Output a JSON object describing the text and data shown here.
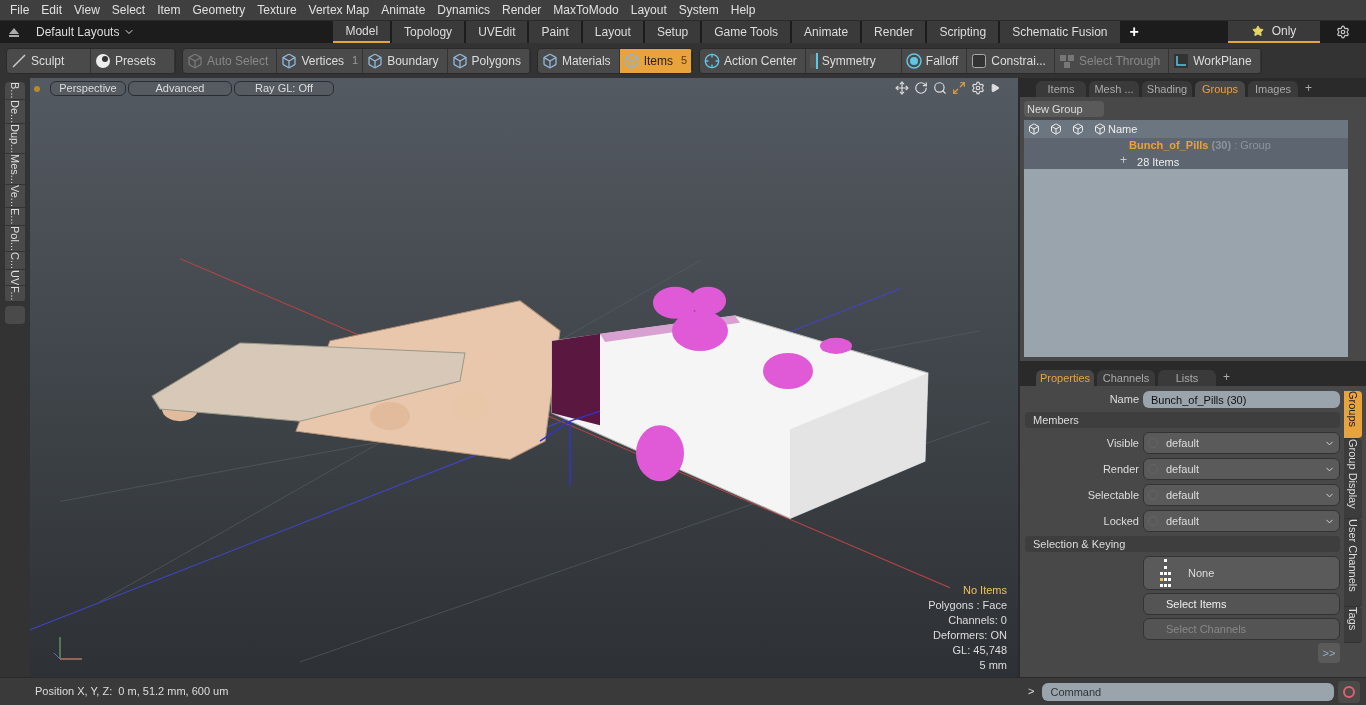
{
  "menu": [
    "File",
    "Edit",
    "View",
    "Select",
    "Item",
    "Geometry",
    "Texture",
    "Vertex Map",
    "Animate",
    "Dynamics",
    "Render",
    "MaxToModo",
    "Layout",
    "System",
    "Help"
  ],
  "layout_bar": {
    "layout_menu": "Default Layouts",
    "tabs": [
      {
        "label": "Model",
        "selected": true
      },
      {
        "label": "Topology",
        "selected": false
      },
      {
        "label": "UVEdit",
        "selected": false
      },
      {
        "label": "Paint",
        "selected": false
      },
      {
        "label": "Layout",
        "selected": false
      },
      {
        "label": "Setup",
        "selected": false
      },
      {
        "label": "Game Tools",
        "selected": false
      },
      {
        "label": "Animate",
        "selected": false
      },
      {
        "label": "Render",
        "selected": false
      },
      {
        "label": "Scripting",
        "selected": false
      },
      {
        "label": "Schematic Fusion",
        "selected": false
      }
    ],
    "add": "+",
    "only": "Only"
  },
  "toolbar": [
    [
      {
        "label": "Sculpt",
        "kind": "sculpt",
        "disabled": false,
        "selected": false
      },
      {
        "label": "Presets",
        "kind": "presets",
        "disabled": false,
        "selected": false
      }
    ],
    [
      {
        "label": "Auto Select",
        "kind": "cube",
        "disabled": true,
        "selected": false
      },
      {
        "label": "Vertices",
        "kind": "cube",
        "disabled": false,
        "selected": false,
        "badge": "1"
      },
      {
        "label": "Boundary",
        "kind": "cube",
        "disabled": false,
        "selected": false
      },
      {
        "label": "Polygons",
        "kind": "cube",
        "disabled": false,
        "selected": false
      }
    ],
    [
      {
        "label": "Materials",
        "kind": "cube",
        "disabled": false,
        "selected": false
      },
      {
        "label": "Items",
        "kind": "cube",
        "disabled": false,
        "selected": true,
        "badge": "5"
      }
    ],
    [
      {
        "label": "Action Center",
        "kind": "crosshair",
        "disabled": false,
        "selected": false
      },
      {
        "label": "Symmetry",
        "kind": "symmetry",
        "disabled": false,
        "selected": false
      },
      {
        "label": "Falloff",
        "kind": "falloff",
        "disabled": false,
        "selected": false
      },
      {
        "label": "Constrai...",
        "kind": "frame",
        "disabled": false,
        "selected": false
      },
      {
        "label": "Select Through",
        "kind": "through",
        "disabled": true,
        "selected": false
      },
      {
        "label": "WorkPlane",
        "kind": "workplane",
        "disabled": false,
        "selected": false
      }
    ]
  ],
  "left_tabs": [
    "B...",
    "De...",
    "Dup...",
    "Mes...",
    "Ve...",
    "E...",
    "Pol...",
    "C...",
    "UV",
    "F..."
  ],
  "viewport": {
    "buttons": [
      "Perspective",
      "Advanced",
      "Ray GL: Off"
    ],
    "stats": [
      {
        "text": "No Items",
        "kind": "highlight"
      },
      {
        "text": "Polygons : Face",
        "kind": "normal"
      },
      {
        "text": "Channels: 0",
        "kind": "normal"
      },
      {
        "text": "Deformers: ON",
        "kind": "normal"
      },
      {
        "text": "GL: 45,748",
        "kind": "normal"
      },
      {
        "text": "5 mm",
        "kind": "normal"
      }
    ]
  },
  "groups_panel": {
    "tabs": [
      {
        "label": "Items",
        "selected": false
      },
      {
        "label": "Mesh ...",
        "selected": false
      },
      {
        "label": "Shading",
        "selected": false
      },
      {
        "label": "Groups",
        "selected": true
      },
      {
        "label": "Images",
        "selected": false
      }
    ],
    "add": "+",
    "new_group": "New Group",
    "name_column": "Name",
    "rows": [
      {
        "name": "Bunch_of_Pills",
        "count": "(30)",
        "type": ": Group",
        "detail": "28 Items",
        "expand": "+",
        "selected": true
      }
    ]
  },
  "properties": {
    "tabs": [
      {
        "label": "Properties",
        "selected": true
      },
      {
        "label": "Channels",
        "selected": false
      },
      {
        "label": "Lists",
        "selected": false
      }
    ],
    "add": "+",
    "name_label": "Name",
    "name_value": "Bunch_of_Pills (30)",
    "members_title": "Members",
    "members": [
      {
        "label": "Visible",
        "value": "default"
      },
      {
        "label": "Render",
        "value": "default"
      },
      {
        "label": "Selectable",
        "value": "default"
      },
      {
        "label": "Locked",
        "value": "default"
      }
    ],
    "selection_title": "Selection & Keying",
    "none_button": "None",
    "buttons": [
      {
        "label": "Select Items",
        "disabled": false
      },
      {
        "label": "Select Channels",
        "disabled": true
      }
    ],
    "more": ">>",
    "side_tabs": [
      {
        "label": "Groups",
        "selected": true
      },
      {
        "label": "Group Display",
        "selected": false
      },
      {
        "label": "User Channels",
        "selected": false
      },
      {
        "label": "Tags",
        "selected": false
      }
    ]
  },
  "status": {
    "position": "Position X, Y, Z:  0 m, 51.2 mm, 600 um",
    "prompt": ">",
    "command_placeholder": "Command"
  }
}
